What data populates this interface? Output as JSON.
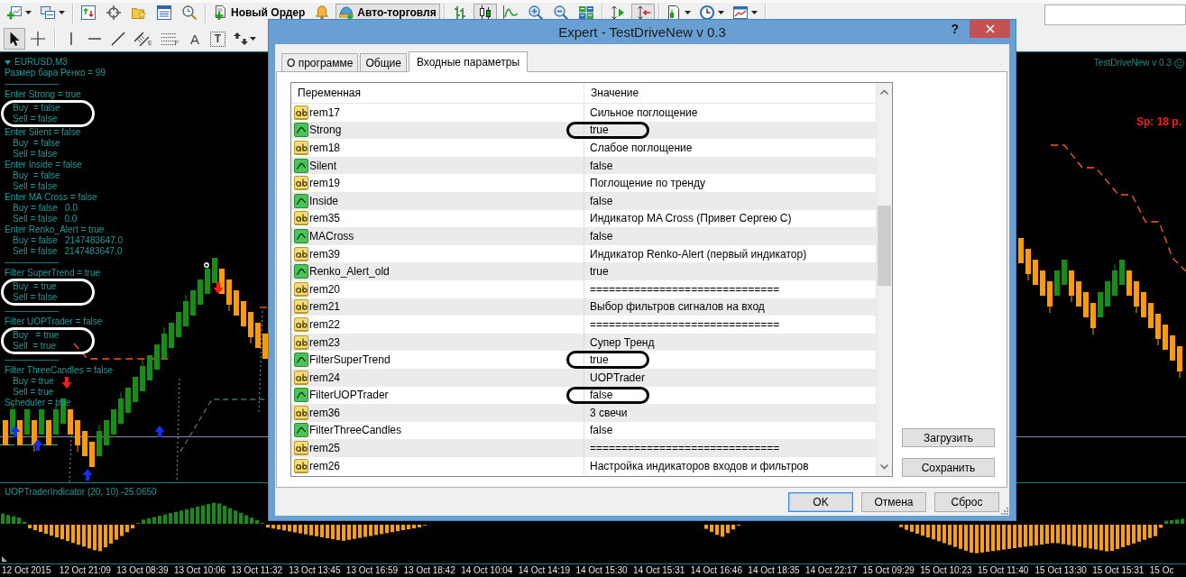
{
  "toolbar": [
    [
      {
        "kind": "dropdown",
        "pressed": false
      },
      {
        "kind": "dropdown",
        "pressed": false
      }
    ],
    [
      {
        "kind": "icon",
        "pressed": false
      },
      {
        "kind": "icon",
        "pressed": false
      },
      {
        "kind": "icon",
        "pressed": false
      },
      {
        "kind": "icon",
        "pressed": false
      },
      {
        "kind": "icon",
        "pressed": false
      }
    ],
    [
      {
        "kind": "text",
        "label": "Новый Ордер",
        "pressed": false
      },
      {
        "kind": "icon",
        "pressed": false
      },
      {
        "kind": "text",
        "label": "Авто-торговля",
        "pressed": true
      }
    ],
    [
      {
        "kind": "icon",
        "pressed": false
      },
      {
        "kind": "icon",
        "pressed": true
      },
      {
        "kind": "icon",
        "pressed": false
      },
      {
        "kind": "icon",
        "pressed": false
      },
      {
        "kind": "icon",
        "pressed": false
      },
      {
        "kind": "icon",
        "pressed": false
      }
    ],
    [
      {
        "kind": "icon",
        "pressed": false
      },
      {
        "kind": "icon",
        "pressed": true
      }
    ],
    [
      {
        "kind": "dropdown",
        "pressed": false
      },
      {
        "kind": "dropdown",
        "pressed": false
      },
      {
        "kind": "dropdown",
        "pressed": false
      }
    ]
  ],
  "drawing_tools": [
    {
      "selected": true
    },
    {
      "selected": false
    },
    {
      "selected": false
    },
    {
      "selected": false
    },
    {
      "selected": false
    },
    {
      "selected": false,
      "subscript": "E"
    },
    {
      "selected": false,
      "subscript": "F"
    },
    {
      "selected": false,
      "label": "A"
    },
    {
      "selected": false,
      "label": "T"
    },
    {
      "selected": false
    }
  ],
  "chart": {
    "symbol": "EURUSD,M3",
    "comment": [
      {
        "text": "Размер бара Ренко = 99",
        "circled": false
      },
      {
        "text": "——————",
        "circled": false
      },
      {
        "text": "Enter Strong = true",
        "children": [
          "Buy  = false",
          "Sell = false"
        ],
        "circled": true
      },
      {
        "text": "Enter Silent = false",
        "children": [
          "Buy  = false",
          "Sell = false"
        ],
        "circled": false
      },
      {
        "text": "Enter Inside = false",
        "children": [
          "Buy  = false",
          "Sell = false"
        ],
        "circled": false
      },
      {
        "text": "Enter MA Cross = false",
        "children": [
          "Buy = false   0.0",
          "Sell = false   0.0"
        ],
        "circled": false
      },
      {
        "text": "Enter Renko_Alert = true",
        "children": [
          "Buy = false   2147483647.0",
          "Sell = false   2147483647.0"
        ],
        "circled": false
      },
      {
        "text": "——————",
        "circled": false
      },
      {
        "text": "Filter SuperTrend = true",
        "children": [
          "Buy  = true",
          "Sell = false"
        ],
        "circled": true
      },
      {
        "text": "——————",
        "circled": false
      },
      {
        "text": "Filter UOPTrader = false",
        "children": [
          "Buy   = true",
          "Sell  = true"
        ],
        "circled": true
      },
      {
        "text": "——————",
        "circled": false
      },
      {
        "text": "Filter ThreeCandles = false",
        "children": [
          "Buy = true",
          "Sell = true"
        ],
        "circled": false
      },
      {
        "text": "Scheduler = true",
        "circled": false
      }
    ],
    "expert": "TestDriveNew v 0.3",
    "spread": "Sp: 18 р."
  },
  "indicator": {
    "label": "UOPTraderIndicator (20, 10) -25.0650"
  },
  "time_axis": [
    "12 Oct 2015",
    "12 Oct 21:09",
    "13 Oct 08:39",
    "13 Oct 10:06",
    "13 Oct 11:32",
    "13 Oct 13:45",
    "13 Oct 16:59",
    "13 Oct 18:42",
    "14 Oct 10:04",
    "14 Oct 14:19",
    "14 Oct 15:30",
    "14 Oct 15:31",
    "14 Oct 16:46",
    "14 Oct 18:35",
    "14 Oct 22:17",
    "15 Oct 09:29",
    "15 Oct 10:23",
    "15 Oct 11:40",
    "15 Oct 13:30",
    "15 Oct 15:31",
    "15 Oc"
  ],
  "dialog": {
    "title": "Expert - TestDriveNew v 0.3",
    "help": "?",
    "tabs": [
      {
        "label": "О программе",
        "selected": false
      },
      {
        "label": "Общие",
        "selected": false
      },
      {
        "label": "Входные параметры",
        "selected": true
      }
    ],
    "columns": [
      "Переменная",
      "Значение"
    ],
    "rows": [
      {
        "kind": "string",
        "name": "rem17",
        "value": "Сильное поглощение",
        "circled": false
      },
      {
        "kind": "bool",
        "name": "Strong",
        "value": "true",
        "circled": true
      },
      {
        "kind": "string",
        "name": "rem18",
        "value": "Слабое поглощение",
        "circled": false
      },
      {
        "kind": "bool",
        "name": "Silent",
        "value": "false",
        "circled": false
      },
      {
        "kind": "string",
        "name": "rem19",
        "value": "Поглощение по тренду",
        "circled": false
      },
      {
        "kind": "bool",
        "name": "Inside",
        "value": "false",
        "circled": false
      },
      {
        "kind": "string",
        "name": "rem35",
        "value": "Индикатор MA Cross (Привет Сергею С)",
        "circled": false
      },
      {
        "kind": "bool",
        "name": "MACross",
        "value": "false",
        "circled": false
      },
      {
        "kind": "string",
        "name": "rem39",
        "value": "Индикатор Renko-Alert (первый индикатор)",
        "circled": false
      },
      {
        "kind": "bool",
        "name": "Renko_Alert_old",
        "value": "true",
        "circled": false
      },
      {
        "kind": "string",
        "name": "rem20",
        "value": "==============================",
        "circled": false
      },
      {
        "kind": "string",
        "name": "rem21",
        "value": "Выбор фильтров сигналов на вход",
        "circled": false
      },
      {
        "kind": "string",
        "name": "rem22",
        "value": "==============================",
        "circled": false
      },
      {
        "kind": "string",
        "name": "rem23",
        "value": "Супер Тренд",
        "circled": false
      },
      {
        "kind": "bool",
        "name": "FilterSuperTrend",
        "value": "true",
        "circled": true
      },
      {
        "kind": "string",
        "name": "rem24",
        "value": "UOPTrader",
        "circled": false
      },
      {
        "kind": "bool",
        "name": "FilterUOPTrader",
        "value": "false",
        "circled": true
      },
      {
        "kind": "string",
        "name": "rem36",
        "value": "3 свечи",
        "circled": false
      },
      {
        "kind": "bool",
        "name": "FilterThreeCandles",
        "value": "false",
        "circled": false
      },
      {
        "kind": "string",
        "name": "rem25",
        "value": "==============================",
        "circled": false
      },
      {
        "kind": "string",
        "name": "rem26",
        "value": "Настройка индикаторов входов и фильтров",
        "circled": false
      }
    ],
    "side_buttons": [
      "Загрузить",
      "Сохранить"
    ],
    "buttons": [
      {
        "label": "OK",
        "default": true
      },
      {
        "label": "Отмена",
        "default": false
      },
      {
        "label": "Сброс",
        "default": false
      }
    ]
  }
}
